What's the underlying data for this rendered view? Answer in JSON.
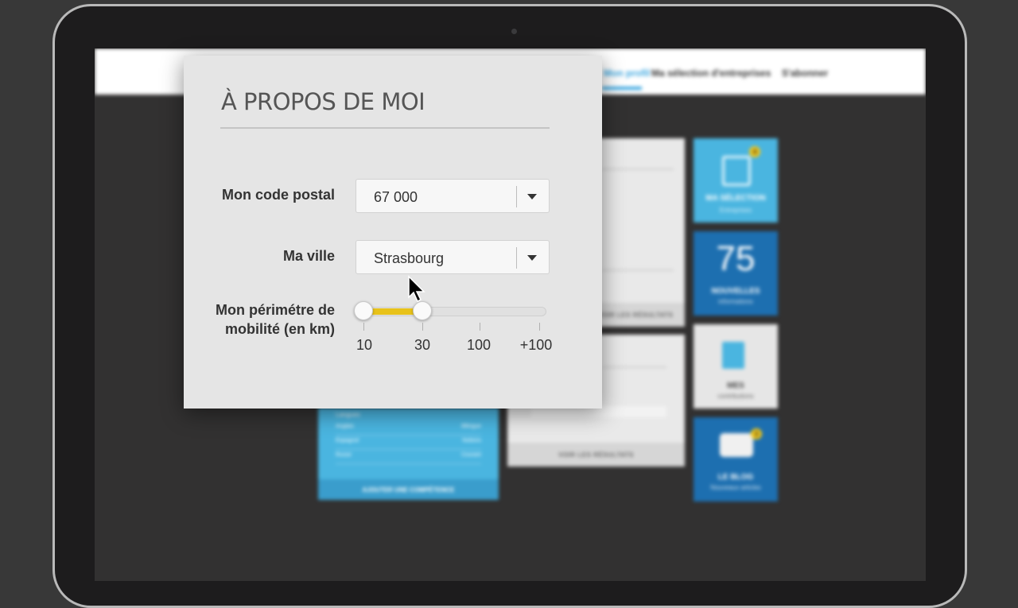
{
  "nav": {
    "items": [
      "Mon profil",
      "Ma sélection d'entreprises",
      "S'abonner"
    ],
    "active_index": 0
  },
  "tiles": [
    {
      "title": "MA SÉLECTION",
      "subtitle": "Entreprises",
      "badge": "4",
      "color": "#4ab5e0",
      "icon": "phones-icon"
    },
    {
      "number": "75",
      "title": "NOUVELLES",
      "subtitle": "informations",
      "color": "#1d6fb0"
    },
    {
      "title": "MES",
      "subtitle": "contributions",
      "color": "#e6e6e6",
      "icon": "documents-icon"
    },
    {
      "title": "LE BLOG",
      "subtitle": "Nouveaux articles",
      "badge": "3",
      "color": "#1d6fb0",
      "icon": "speech-bubble-icon"
    }
  ],
  "cards": {
    "card1_button": "VOIR LES RÉSULTATS",
    "card2_button": "VOIR LES RÉSULTATS"
  },
  "skills": {
    "header": "Langues",
    "rows": [
      {
        "name": "Anglais",
        "level": "Bilingue"
      },
      {
        "name": "Espagnol",
        "level": "Notions"
      },
      {
        "name": "Russe",
        "level": "Courant"
      }
    ],
    "add_button": "AJOUTER UNE COMPÉTENCE"
  },
  "panel": {
    "title": "À PROPOS DE MOI",
    "postal_label": "Mon code postal",
    "postal_value": "67 000",
    "city_label": "Ma ville",
    "city_value": "Strasbourg",
    "mobility_label_line1": "Mon périmétre de",
    "mobility_label_line2": "mobilité (en km)",
    "mobility_ticks": [
      "10",
      "30",
      "100",
      "+100"
    ],
    "mobility_range": [
      "10",
      "30"
    ],
    "accent_color": "#e8c21a"
  }
}
